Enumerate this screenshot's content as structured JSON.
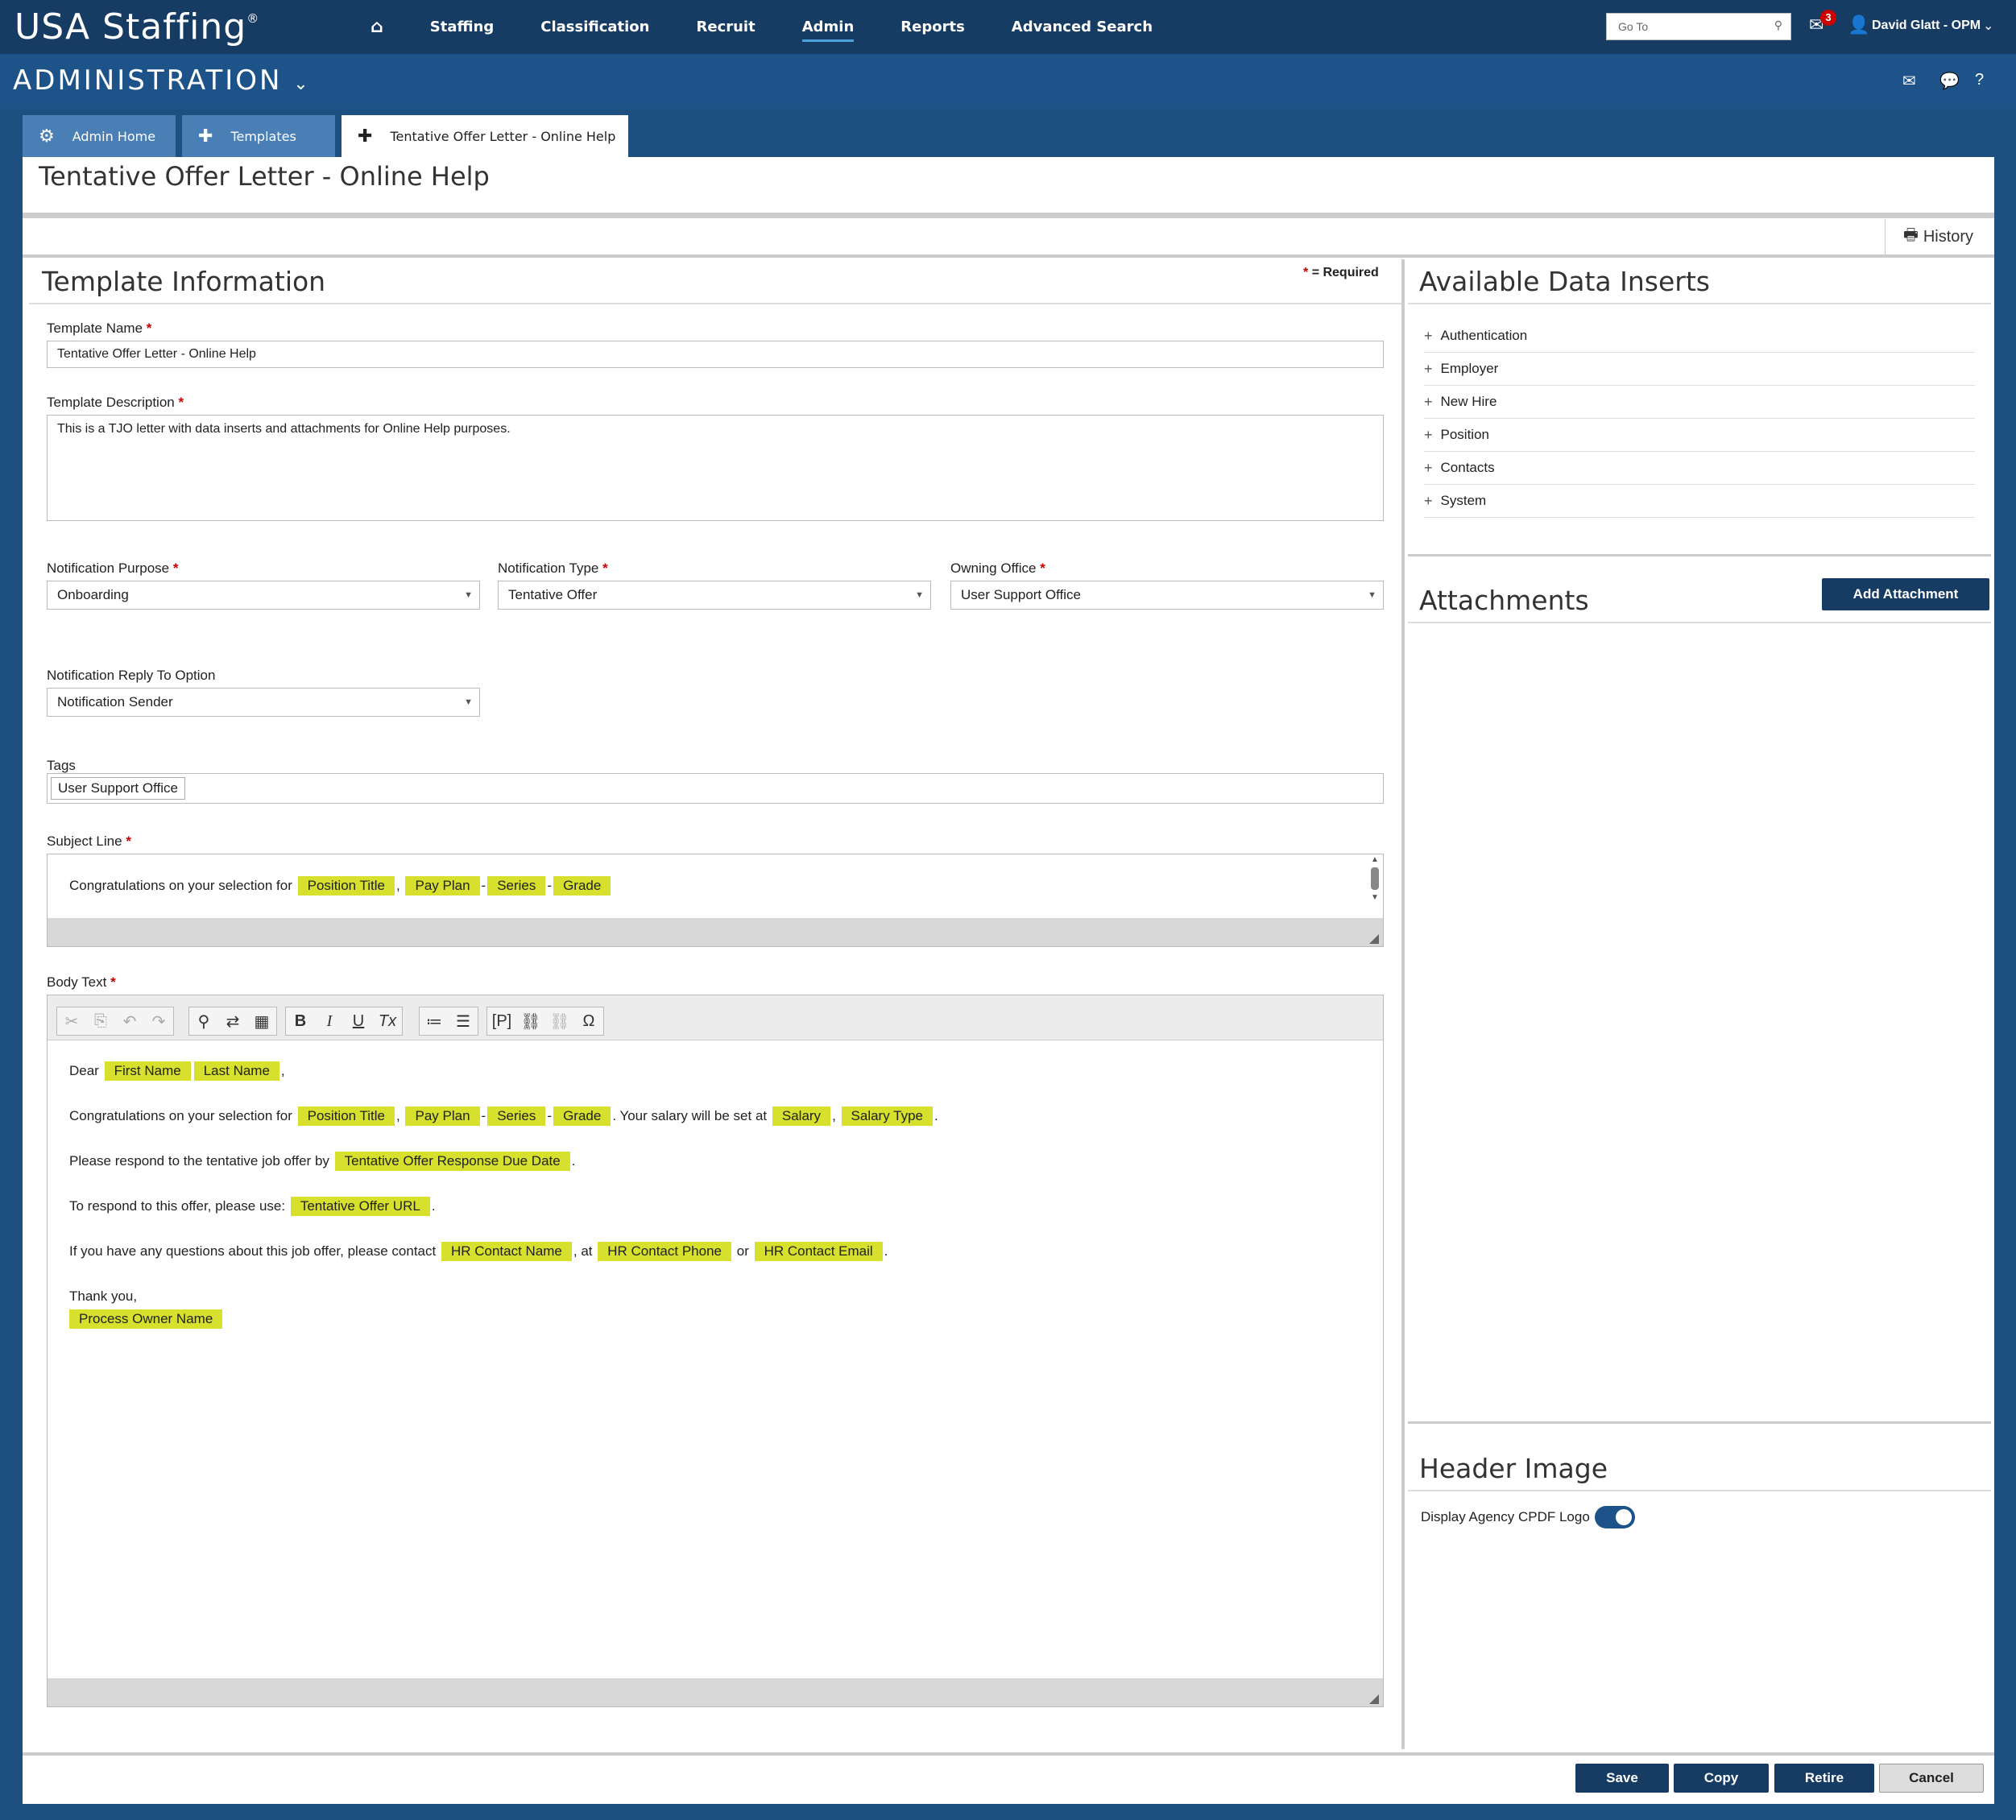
{
  "app": {
    "logo": "USA Staffing",
    "logo_mark": "®"
  },
  "nav": {
    "home": "home-icon",
    "items": [
      "Staffing",
      "Classification",
      "Recruit",
      "Admin",
      "Reports",
      "Advanced Search"
    ],
    "active": "Admin"
  },
  "header": {
    "goto_placeholder": "Go To",
    "mail_badge": "3",
    "user": "David Glatt - OPM"
  },
  "section": {
    "title": "ADMINISTRATION"
  },
  "tabs": [
    {
      "label": "Admin Home"
    },
    {
      "label": "Templates"
    },
    {
      "label": "Tentative Offer Letter - Online Help"
    }
  ],
  "page": {
    "title": "Tentative Offer Letter - Online Help",
    "history": "History"
  },
  "template_info": {
    "title": "Template Information",
    "required_note": "= Required",
    "name_label": "Template Name",
    "name_value": "Tentative Offer Letter - Online Help",
    "desc_label": "Template Description",
    "desc_value": "This is a TJO letter with data inserts and attachments for Online Help purposes.",
    "purpose_label": "Notification Purpose",
    "purpose_value": "Onboarding",
    "type_label": "Notification Type",
    "type_value": "Tentative Offer",
    "office_label": "Owning Office",
    "office_value": "User Support Office",
    "reply_label": "Notification Reply To Option",
    "reply_value": "Notification Sender",
    "tags_label": "Tags",
    "tag": "User Support Office",
    "subject_label": "Subject Line",
    "body_label": "Body Text"
  },
  "subject": {
    "text": "Congratulations on your selection for",
    "i1": "Position Title",
    "i2": "Pay Plan",
    "i3": "Series",
    "i4": "Grade",
    "c1": ",",
    "c2": "-",
    "c3": "-"
  },
  "body": {
    "dear": "Dear",
    "first": "First Name",
    "last": "Last Name",
    "comma": ",",
    "l2": "Congratulations on your selection for",
    "l2_i1": "Position Title",
    "l2_i2": "Pay Plan",
    "l2_i3": "Series",
    "l2_i4": "Grade",
    "l2_t": ". Your salary will be set at",
    "l2_i5": "Salary",
    "l2_i6": "Salary Type",
    "dot": ".",
    "dash": "-",
    "l3": "Please respond to the tentative job offer by",
    "l3_i": "Tentative Offer Response Due Date",
    "l4": "To respond to this offer, please use:",
    "l4_i": "Tentative Offer URL",
    "l5": "If you have any questions about this job offer, please contact",
    "l5_i1": "HR Contact Name",
    "l5_t1": ", at",
    "l5_i2": "HR Contact Phone",
    "l5_t2": "or",
    "l5_i3": "HR Contact Email",
    "l6": "Thank you,",
    "l6_i": "Process Owner Name"
  },
  "data_inserts": {
    "title": "Available Data Inserts",
    "items": [
      "Authentication",
      "Employer",
      "New Hire",
      "Position",
      "Contacts",
      "System"
    ]
  },
  "attachments": {
    "title": "Attachments",
    "add": "Add Attachment"
  },
  "header_image": {
    "title": "Header Image",
    "toggle_label": "Display Agency CPDF Logo",
    "toggle_on": true
  },
  "footer": {
    "save": "Save",
    "copy": "Copy",
    "retire": "Retire",
    "cancel": "Cancel"
  },
  "colors": {
    "topbar": "#173c63",
    "adminbar": "#1d5389",
    "insert": "#d6e02d",
    "required": "#cc0000"
  }
}
